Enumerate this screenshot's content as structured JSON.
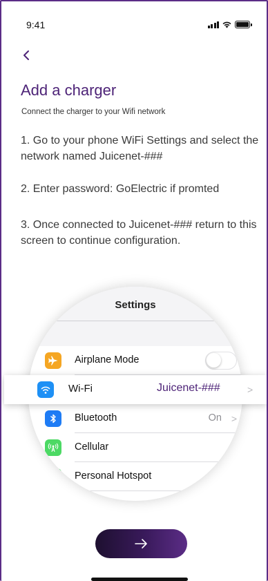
{
  "status_bar": {
    "time": "9:41"
  },
  "header": {
    "title": "Add a charger",
    "subtitle": "Connect the charger to your Wifi network"
  },
  "steps": [
    "1. Go to your phone WiFi Settings and select the network named Juicenet-###",
    "2. Enter password: GoElectric if promted",
    "3. Once connected to Juicenet-### return to this screen to continue configuration."
  ],
  "illustration": {
    "title": "Settings",
    "rows": [
      {
        "label": "Airplane Mode",
        "icon": "airplane-icon",
        "color": "#f5a623"
      },
      {
        "label": "Wi-Fi",
        "icon": "wifi-icon",
        "color": "#1e90f5",
        "value": "Juicenet-###"
      },
      {
        "label": "Bluetooth",
        "icon": "bluetooth-icon",
        "color": "#1e7cf5",
        "value": "On"
      },
      {
        "label": "Cellular",
        "icon": "cellular-icon",
        "color": "#4cd964"
      },
      {
        "label": "Personal Hotspot",
        "icon": "hotspot-icon",
        "color": "#4cd964"
      }
    ]
  },
  "colors": {
    "accent": "#4d2377",
    "button_dark": "#1e1030",
    "button_light": "#5b2d86"
  }
}
